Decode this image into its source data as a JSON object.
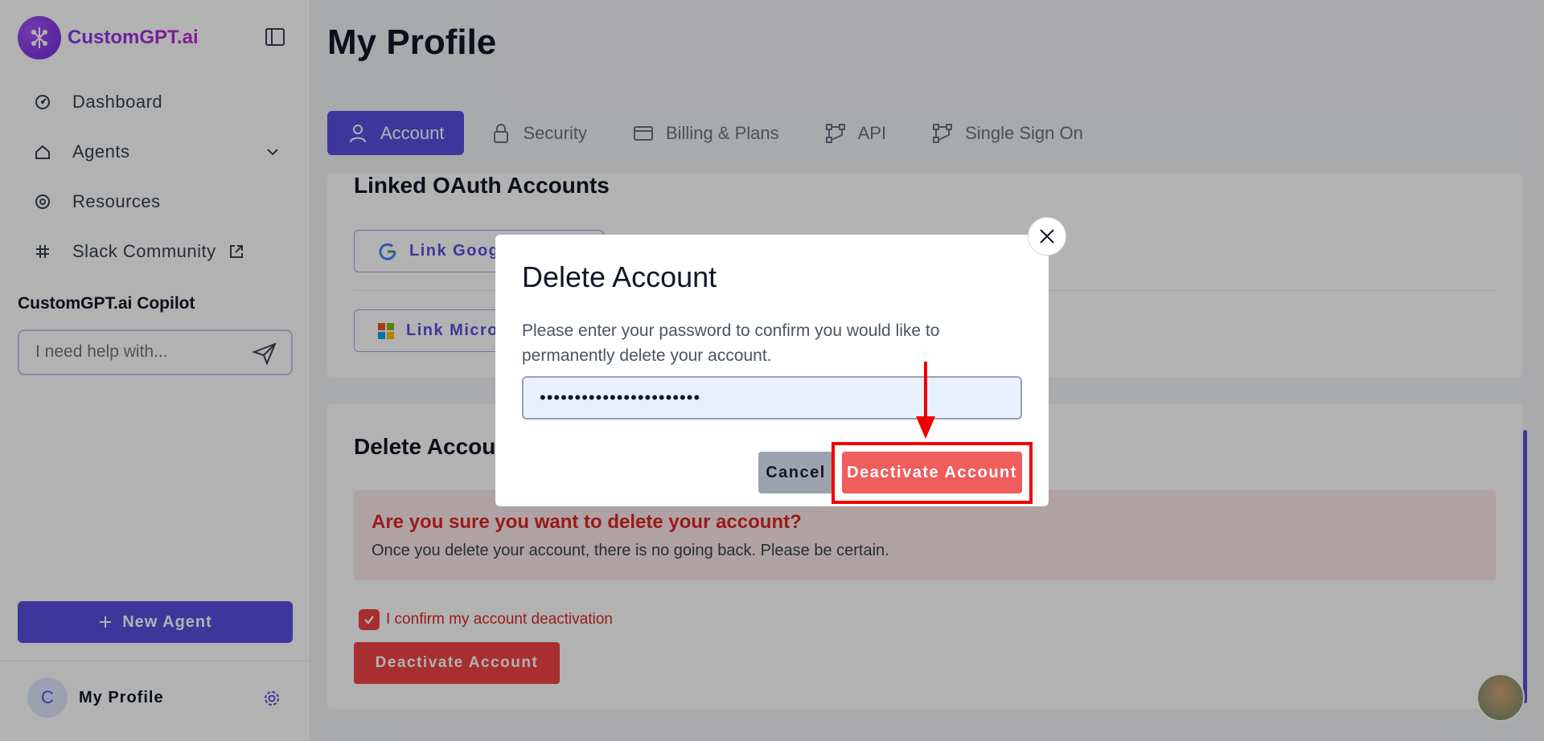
{
  "brand": {
    "name": "CustomGPT.ai"
  },
  "sidebar": {
    "items": [
      {
        "label": "Dashboard"
      },
      {
        "label": "Agents"
      },
      {
        "label": "Resources"
      },
      {
        "label": "Slack Community"
      }
    ],
    "copilot_title": "CustomGPT.ai Copilot",
    "copilot_placeholder": "I need help with...",
    "new_agent_label": "New Agent",
    "profile": {
      "initial": "C",
      "name": "My Profile"
    }
  },
  "main": {
    "title": "My Profile",
    "tabs": [
      {
        "label": "Account"
      },
      {
        "label": "Security"
      },
      {
        "label": "Billing & Plans"
      },
      {
        "label": "API"
      },
      {
        "label": "Single Sign On"
      }
    ],
    "oauth": {
      "title": "Linked OAuth Accounts",
      "google_label": "Link Googl",
      "microsoft_label": "Link Micro"
    },
    "delete_section": {
      "title": "Delete Accou",
      "warning_title": "Are you sure you want to delete your account?",
      "warning_body": "Once you delete your account, there is no going back. Please be certain.",
      "confirm_label": "I confirm my account deactivation",
      "button_label": "Deactivate Account"
    }
  },
  "modal": {
    "title": "Delete Account",
    "text": "Please enter your password to confirm you would like to permanently delete your account.",
    "password_value": "•••••••••••••••••••••••",
    "cancel_label": "Cancel",
    "deactivate_label": "Deactivate Account"
  },
  "colors": {
    "accent": "#5b4ee0",
    "danger": "#ef4444",
    "highlight": "#ef0000"
  }
}
